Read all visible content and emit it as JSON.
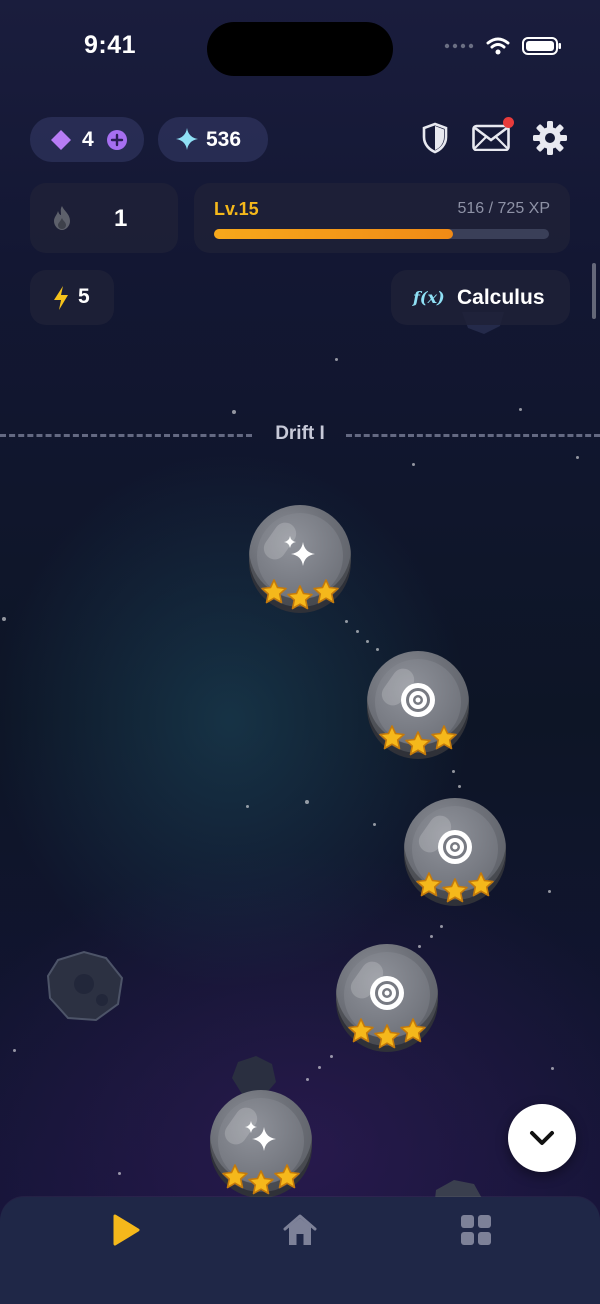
{
  "status_bar": {
    "time": "9:41"
  },
  "currency": {
    "gems": "4",
    "sparks": "536"
  },
  "streak": {
    "count": "1"
  },
  "level": {
    "label": "Lv.15",
    "xp_text": "516 / 725 XP",
    "xp_fraction": 0.712
  },
  "energy": {
    "count": "5"
  },
  "subject": {
    "symbol": "f(x)",
    "name": "Calculus"
  },
  "section": {
    "title": "Drift I"
  },
  "nodes": [
    {
      "type": "sparkle",
      "stars": 3
    },
    {
      "type": "target",
      "stars": 3
    },
    {
      "type": "target",
      "stars": 3
    },
    {
      "type": "target",
      "stars": 3
    },
    {
      "type": "sparkle",
      "stars": 3
    }
  ],
  "nav": {
    "items": [
      "play-icon",
      "home-icon",
      "grid-icon"
    ],
    "active": "play-icon"
  },
  "colors": {
    "accent": "#f5b81b",
    "gem": "#b77cf5",
    "spark": "#8fe0f5",
    "notification": "#e83b3b",
    "xp_bar": "#f5a31b"
  }
}
